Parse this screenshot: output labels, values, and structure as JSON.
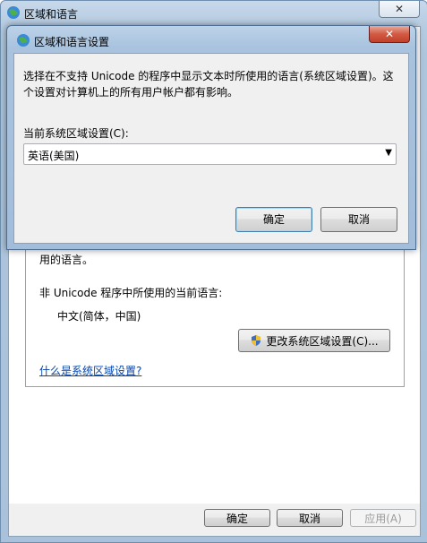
{
  "outer": {
    "title": "区域和语言",
    "close": "✕",
    "panel_text_line": "用的语言。",
    "current_label": "非 Unicode 程序中所使用的当前语言:",
    "current_value": "中文(简体，中国)",
    "change_button": "更改系统区域设置(C)...",
    "help_link": "什么是系统区域设置?",
    "ok": "确定",
    "cancel": "取消",
    "apply": "应用(A)"
  },
  "dialog": {
    "title": "区域和语言设置",
    "close": "✕",
    "description": "选择在不支持 Unicode 的程序中显示文本时所使用的语言(系统区域设置)。这个设置对计算机上的所有用户帐户都有影响。",
    "field_label": "当前系统区域设置(C):",
    "selected_locale": "英语(美国)",
    "ok": "确定",
    "cancel": "取消"
  },
  "colors": {
    "accent": "#3c7fb1",
    "close_red": "#c1402a",
    "link": "#0645ad"
  }
}
